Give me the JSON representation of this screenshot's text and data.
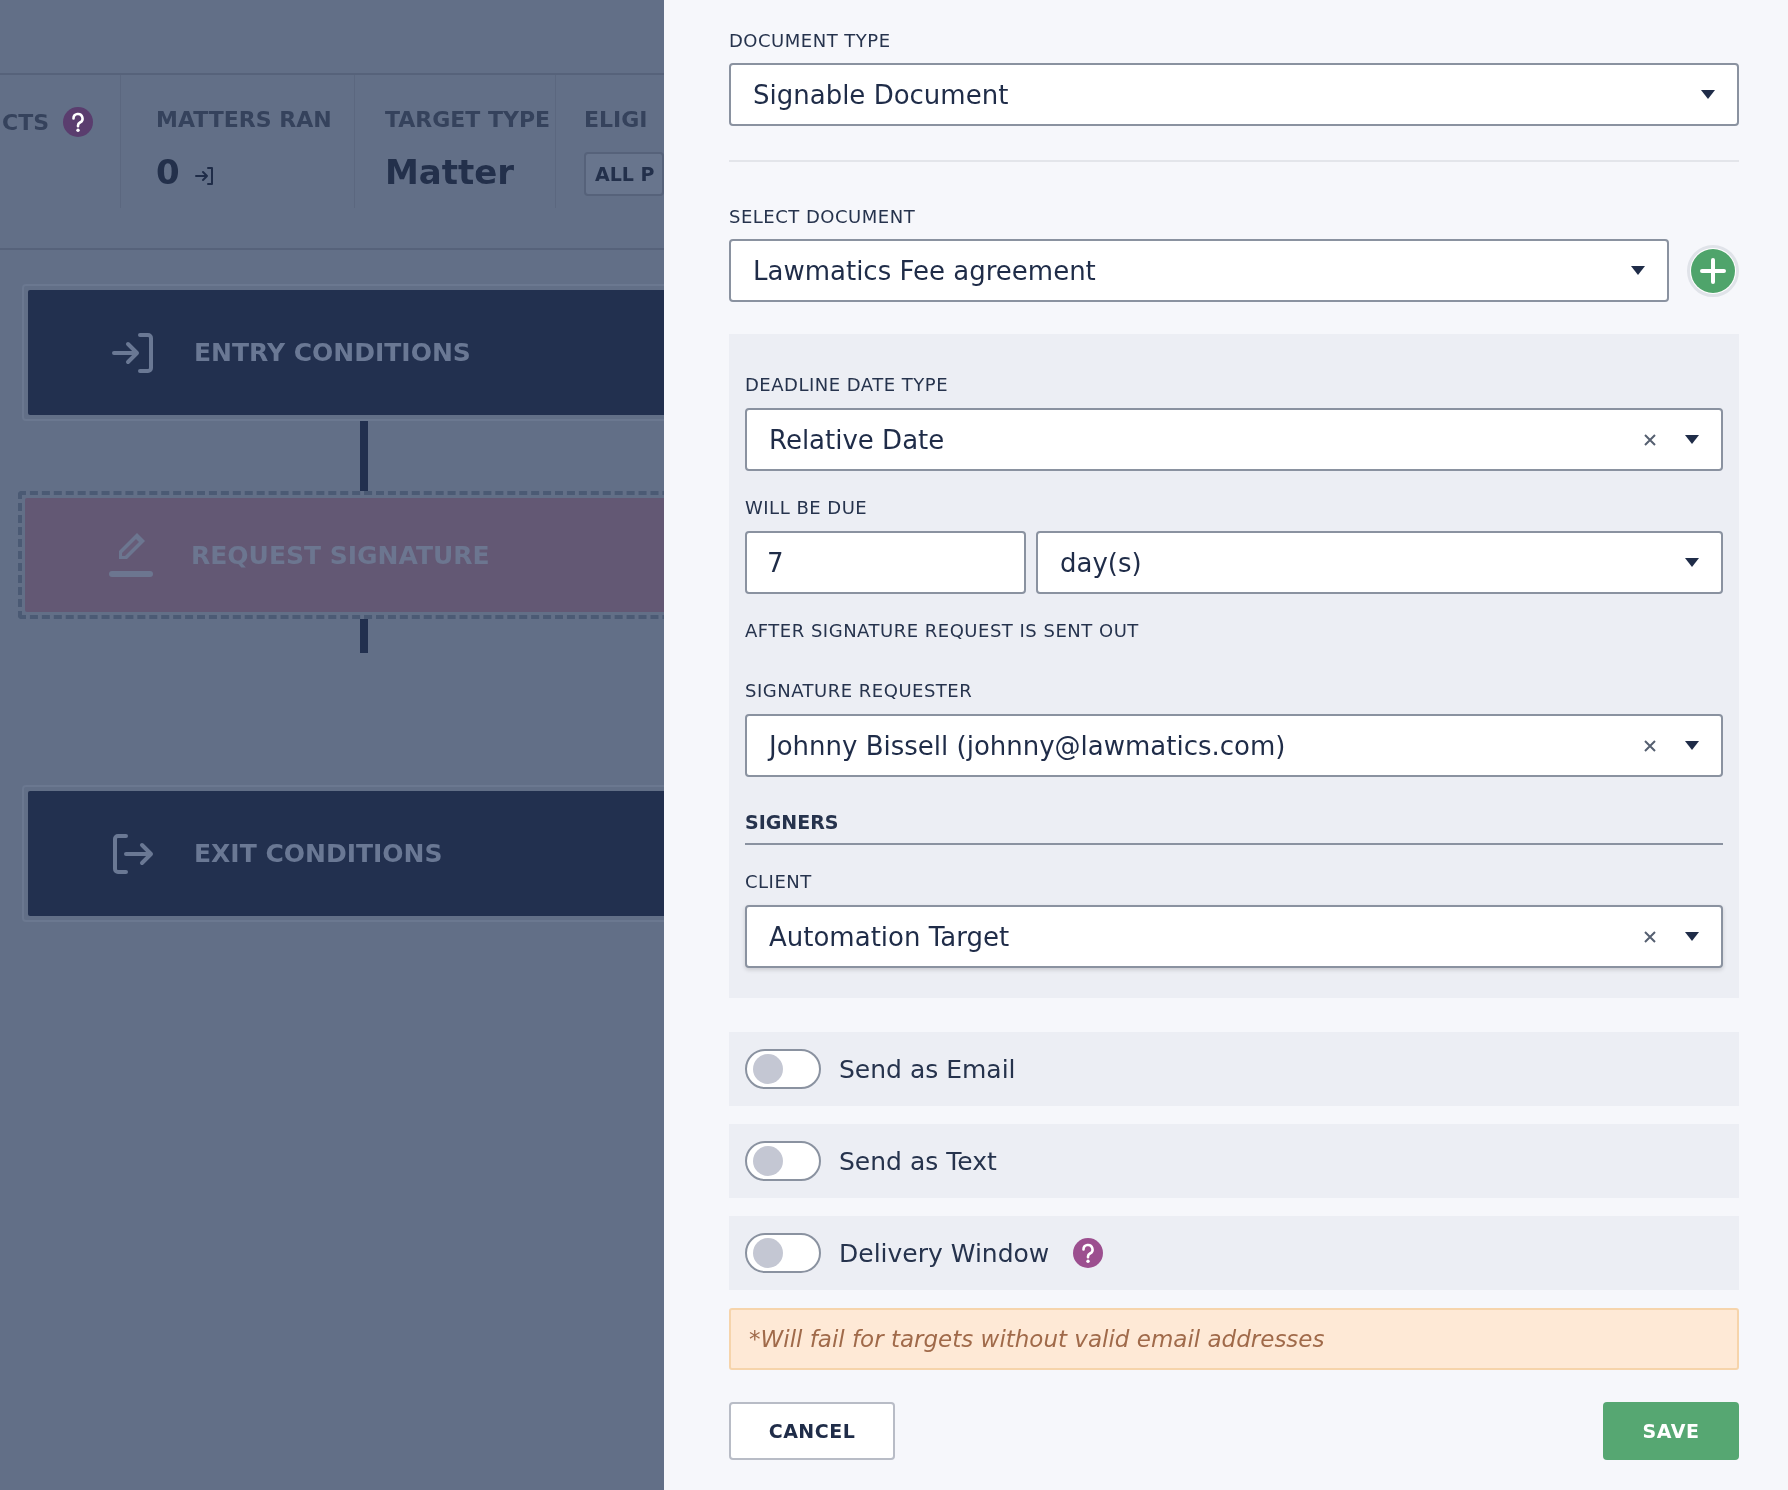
{
  "background": {
    "stats": [
      {
        "kind": "help",
        "label": "CTS"
      },
      {
        "kind": "count",
        "label": "MATTERS RAN",
        "value": "0"
      },
      {
        "kind": "text",
        "label": "TARGET TYPE",
        "value": "Matter"
      },
      {
        "kind": "button",
        "label": "ELIGI",
        "value": "ALL P"
      }
    ],
    "cards": [
      {
        "kind": "entry",
        "label": "ENTRY CONDITIONS",
        "selected": false
      },
      {
        "kind": "signature",
        "label": "REQUEST SIGNATURE",
        "selected": true
      },
      {
        "kind": "exit",
        "label": "EXIT CONDITIONS",
        "selected": false
      }
    ]
  },
  "panel": {
    "document_type": {
      "label": "DOCUMENT TYPE",
      "value": "Signable Document"
    },
    "select_document": {
      "label": "SELECT DOCUMENT",
      "value": "Lawmatics Fee agreement"
    },
    "deadline": {
      "date_type": {
        "label": "DEADLINE DATE TYPE",
        "value": "Relative Date",
        "clearable": true
      },
      "will_be_due": {
        "label": "WILL BE DUE",
        "amount": "7",
        "unit": "day(s)"
      },
      "note": "AFTER SIGNATURE REQUEST IS SENT OUT",
      "requester": {
        "label": "SIGNATURE REQUESTER",
        "value": "Johnny Bissell (johnny@lawmatics.com)",
        "clearable": true
      },
      "signers_heading": "SIGNERS",
      "client": {
        "label": "CLIENT",
        "value": "Automation Target",
        "clearable": true
      }
    },
    "toggles": [
      {
        "label": "Send as Email",
        "on": false,
        "help": false
      },
      {
        "label": "Send as Text",
        "on": false,
        "help": false
      },
      {
        "label": "Delivery Window",
        "on": false,
        "help": true
      }
    ],
    "warning": "*Will fail for targets without valid email addresses",
    "buttons": [
      {
        "kind": "secondary",
        "label": "CANCEL"
      },
      {
        "kind": "primary",
        "label": "SAVE"
      }
    ]
  }
}
